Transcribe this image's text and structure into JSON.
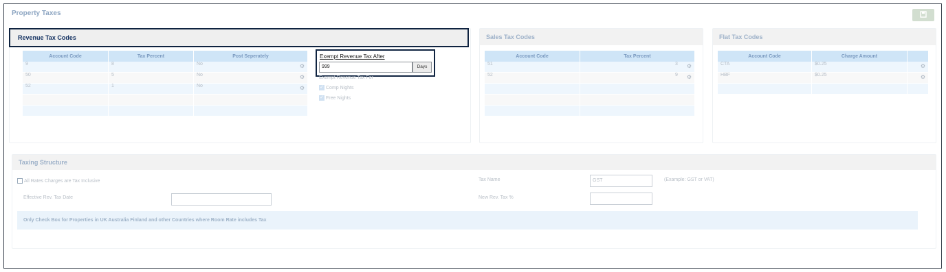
{
  "page": {
    "title": "Property Taxes",
    "save_icon": "save-icon"
  },
  "revenue": {
    "title": "Revenue Tax Codes",
    "headers": [
      "Account Code",
      "Tax Percent",
      "Post Seperately"
    ],
    "rows": [
      {
        "code": "9",
        "percent": "8",
        "post": "No"
      },
      {
        "code": "50",
        "percent": "5",
        "post": "No"
      },
      {
        "code": "52",
        "percent": "1",
        "post": "No"
      }
    ]
  },
  "exempt": {
    "after_label": "Exempt Revenue Tax After",
    "after_value": "999",
    "days_label": "Days",
    "for_label": "Exempt Revenue Tax For",
    "comp_label": "Comp Nights",
    "free_label": "Free Nights"
  },
  "sales": {
    "title": "Sales Tax Codes",
    "headers": [
      "Account Code",
      "Tax Percent"
    ],
    "rows": [
      {
        "code": "51",
        "percent": "3"
      },
      {
        "code": "52",
        "percent": "9"
      }
    ]
  },
  "flat": {
    "title": "Flat Tax Codes",
    "headers": [
      "Account Code",
      "Charge Amount"
    ],
    "rows": [
      {
        "code": "CTA",
        "amount": "$0.25"
      },
      {
        "code": "HBF",
        "amount": "$0.25"
      }
    ]
  },
  "structure": {
    "title": "Taxing Structure",
    "inclusive_label": "All Rates Charges are Tax Inclusive",
    "effective_label": "Effective Rev. Tax Date",
    "tax_name_label": "Tax Name",
    "tax_name_placeholder": "GST",
    "example_label": "(Example: GST or VAT)",
    "new_rev_label": "New Rev. Tax %",
    "note": "Only Check Box for Properties in UK Australia Finland and other Countries where Room Rate includes Tax"
  }
}
